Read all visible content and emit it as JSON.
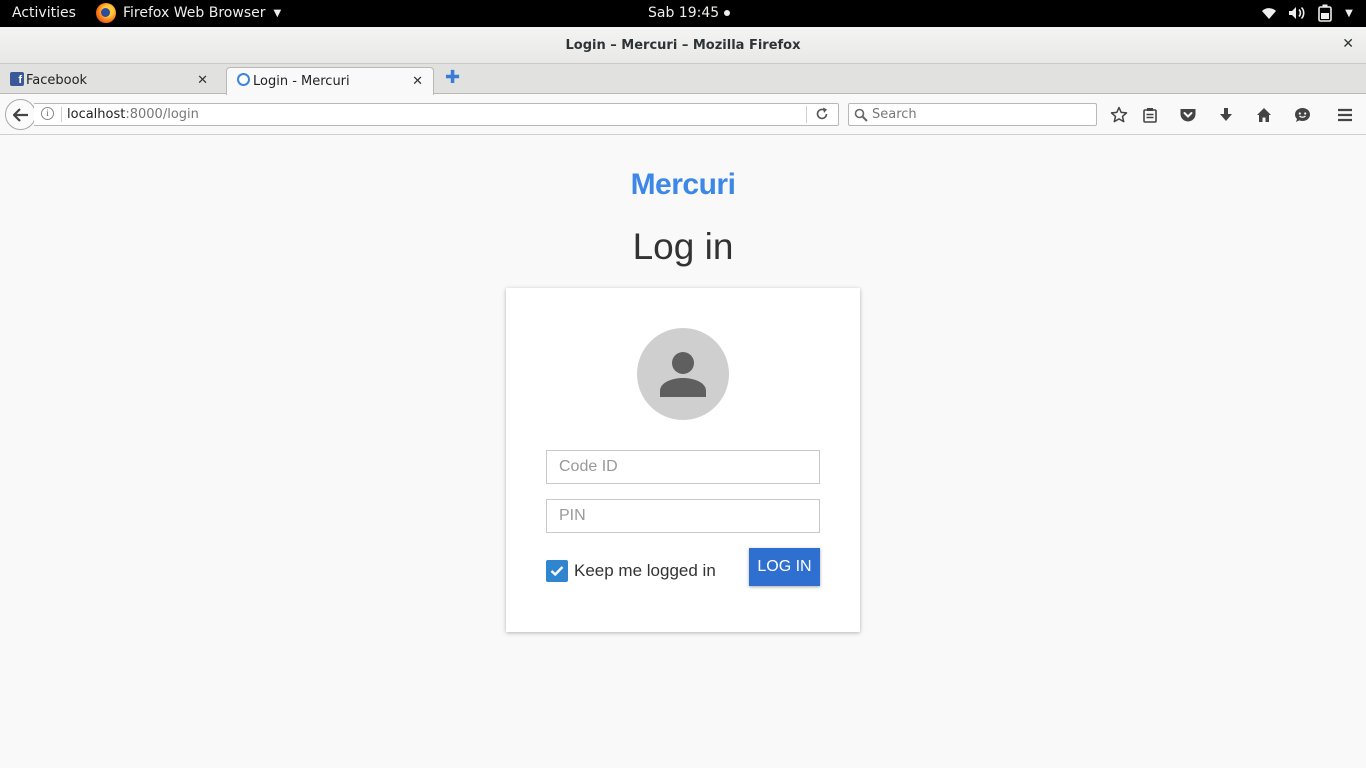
{
  "system_bar": {
    "activities": "Activities",
    "app_name": "Firefox Web Browser",
    "clock": "Sab 19:45"
  },
  "window": {
    "title": "Login – Mercuri – Mozilla Firefox"
  },
  "tabs": [
    {
      "label": "Facebook"
    },
    {
      "label": "Login - Mercuri",
      "active": true
    }
  ],
  "navbar": {
    "url_host": "localhost",
    "url_rest": ":8000/login",
    "search_placeholder": "Search"
  },
  "page": {
    "brand": "Mercuri",
    "heading": "Log in",
    "code_placeholder": "Code ID",
    "pin_placeholder": "PIN",
    "remember_label": "Keep me logged in",
    "remember_checked": true,
    "login_button": "LOG IN"
  },
  "colors": {
    "brand": "#3d88e6",
    "button": "#2f6fd0",
    "checkbox": "#2f86cf"
  }
}
